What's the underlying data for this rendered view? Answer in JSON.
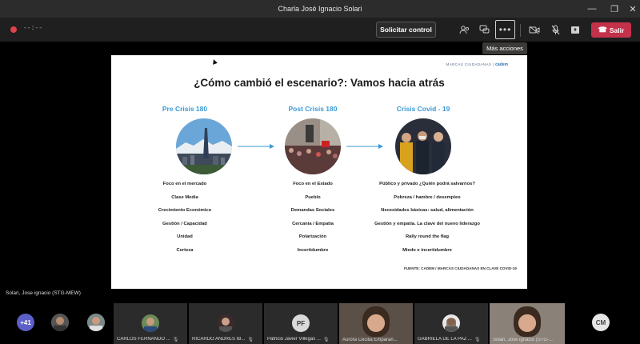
{
  "window": {
    "title": "Charla José Ignacio Solari",
    "controls": [
      "minimize-icon",
      "maximize-icon",
      "close-icon"
    ]
  },
  "toolbar": {
    "timer": "--:--",
    "request_control_label": "Solicitar control",
    "leave_label": "Salir",
    "more_tooltip": "Más acciones",
    "icons": [
      "participants-icon",
      "chat-icon",
      "more-icon",
      "camera-off-icon",
      "mic-off-icon",
      "share-icon"
    ],
    "leave_color": "#c4314b"
  },
  "slide": {
    "brand": "MARCAS CIUDADANAS",
    "brand_logo": "cadem",
    "headline": "¿Cómo cambió el escenario?: Vamos hacia atrás",
    "accent_color": "#3a9bd5",
    "columns": [
      {
        "title": "Pre Crisis 180",
        "items": [
          "Foco en el mercado",
          "Clase Media",
          "Crecimiento Económico",
          "Gestión / Capacidad",
          "Unidad",
          "Certeza"
        ]
      },
      {
        "title": "Post Crisis 180",
        "items": [
          "Foco en el Estado",
          "Pueblo",
          "Demandas Sociales",
          "Cercanía / Empatía",
          "Polarización",
          "Incertidumbre"
        ]
      },
      {
        "title": "Crisis Covid - 19",
        "items": [
          "Público y privado ¿Quién podrá salvarnos?",
          "Pobreza / hambre / desempleo",
          "Necesidades básicas: salud, alimentación",
          "Gestión y empatía. La clave del nuevo liderazgo",
          "Rally round the flag",
          "Miedo e incertidumbre"
        ]
      }
    ],
    "source": "FUENTE: CADEM / MARCAS CIUDADANAS EN CLAVE COVID-19"
  },
  "presenter_label": "Solari, Jose ignacio (STG-MEW)",
  "participants": {
    "overflow_count": "+41",
    "tiles": [
      {
        "name": "CARLOS FERNANDO ..."
      },
      {
        "name": "RICARDO ANDRÉS IB..."
      },
      {
        "name": "Patricio Javier Villegas ...",
        "initials": "PF"
      },
      {
        "name": "Aurora Cecilia Emparan..."
      },
      {
        "name": "GABRIELA DE LA PAZ ..."
      },
      {
        "name": "Solari, Jose ignacio (STG-..."
      }
    ],
    "last_initials": "CM"
  }
}
